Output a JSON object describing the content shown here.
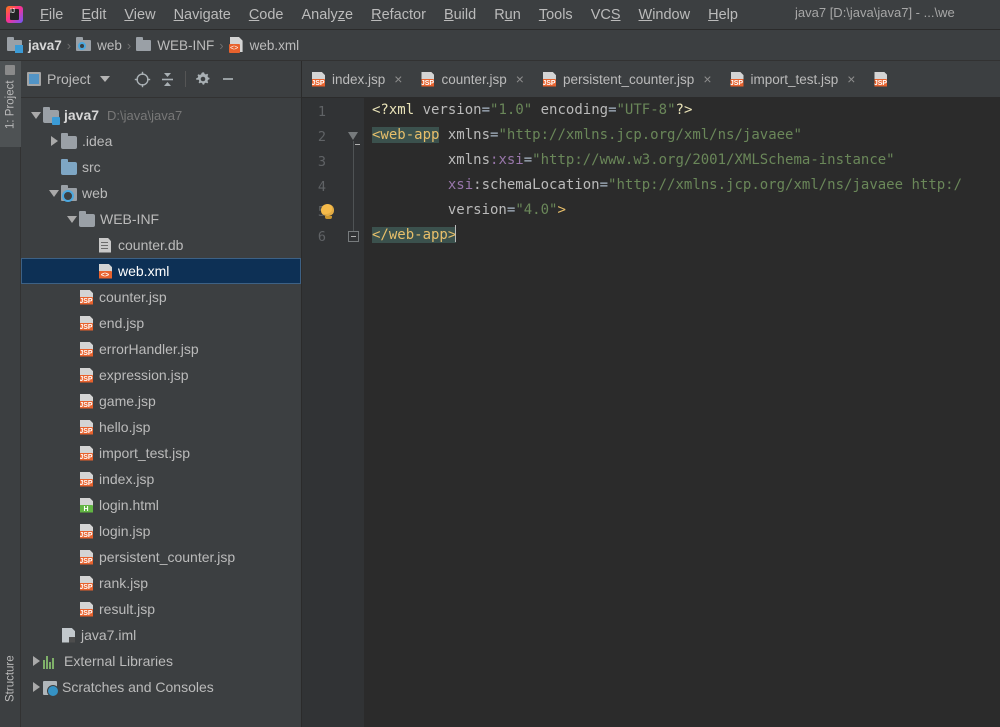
{
  "window": {
    "title": "java7 [D:\\java\\java7] - ...\\we",
    "logo_icon": "intellij-idea-logo"
  },
  "menubar": {
    "items": [
      {
        "label": "File",
        "mnemonic": "F"
      },
      {
        "label": "Edit",
        "mnemonic": "E"
      },
      {
        "label": "View",
        "mnemonic": "V"
      },
      {
        "label": "Navigate",
        "mnemonic": "N"
      },
      {
        "label": "Code",
        "mnemonic": "C"
      },
      {
        "label": "Analyze",
        "mnemonic": "z"
      },
      {
        "label": "Refactor",
        "mnemonic": "R"
      },
      {
        "label": "Build",
        "mnemonic": "B"
      },
      {
        "label": "Run",
        "mnemonic": "u"
      },
      {
        "label": "Tools",
        "mnemonic": "T"
      },
      {
        "label": "VCS",
        "mnemonic": "S"
      },
      {
        "label": "Window",
        "mnemonic": "W"
      },
      {
        "label": "Help",
        "mnemonic": "H"
      }
    ]
  },
  "breadcrumb": {
    "items": [
      {
        "label": "java7",
        "icon": "module-folder-icon"
      },
      {
        "label": "web",
        "icon": "web-folder-icon"
      },
      {
        "label": "WEB-INF",
        "icon": "folder-icon"
      },
      {
        "label": "web.xml",
        "icon": "xml-file-icon"
      }
    ],
    "separator": "›"
  },
  "left_strip": {
    "project_tab": "1: Project",
    "structure_tab": "Structure"
  },
  "project_panel": {
    "title": "Project",
    "title_icon": "project-view-icon",
    "toolbar": [
      {
        "name": "locate-icon",
        "glyph": "⊕"
      },
      {
        "name": "collapse-all-icon",
        "glyph": "≡"
      },
      {
        "name": "settings-gear-icon",
        "glyph": "⚙"
      },
      {
        "name": "hide-panel-icon",
        "glyph": "−"
      }
    ],
    "tree": [
      {
        "label": "java7",
        "path": "D:\\java\\java7",
        "depth": 0,
        "arrow": "open",
        "icon": "module-folder",
        "bold": true,
        "selected": false
      },
      {
        "label": ".idea",
        "path": "",
        "depth": 1,
        "arrow": "closed",
        "icon": "folder",
        "bold": false,
        "selected": false
      },
      {
        "label": "src",
        "path": "",
        "depth": 1,
        "arrow": "none",
        "icon": "source-folder",
        "bold": false,
        "selected": false
      },
      {
        "label": "web",
        "path": "",
        "depth": 1,
        "arrow": "open",
        "icon": "web-folder",
        "bold": false,
        "selected": false
      },
      {
        "label": "WEB-INF",
        "path": "",
        "depth": 2,
        "arrow": "open",
        "icon": "folder",
        "bold": false,
        "selected": false
      },
      {
        "label": "counter.db",
        "path": "",
        "depth": 3,
        "arrow": "none",
        "icon": "db-file",
        "bold": false,
        "selected": false
      },
      {
        "label": "web.xml",
        "path": "",
        "depth": 3,
        "arrow": "none",
        "icon": "xml-file",
        "bold": false,
        "selected": true
      },
      {
        "label": "counter.jsp",
        "path": "",
        "depth": 2,
        "arrow": "none",
        "icon": "jsp-file",
        "bold": false,
        "selected": false
      },
      {
        "label": "end.jsp",
        "path": "",
        "depth": 2,
        "arrow": "none",
        "icon": "jsp-file",
        "bold": false,
        "selected": false
      },
      {
        "label": "errorHandler.jsp",
        "path": "",
        "depth": 2,
        "arrow": "none",
        "icon": "jsp-file",
        "bold": false,
        "selected": false
      },
      {
        "label": "expression.jsp",
        "path": "",
        "depth": 2,
        "arrow": "none",
        "icon": "jsp-file",
        "bold": false,
        "selected": false
      },
      {
        "label": "game.jsp",
        "path": "",
        "depth": 2,
        "arrow": "none",
        "icon": "jsp-file",
        "bold": false,
        "selected": false
      },
      {
        "label": "hello.jsp",
        "path": "",
        "depth": 2,
        "arrow": "none",
        "icon": "jsp-file",
        "bold": false,
        "selected": false
      },
      {
        "label": "import_test.jsp",
        "path": "",
        "depth": 2,
        "arrow": "none",
        "icon": "jsp-file",
        "bold": false,
        "selected": false
      },
      {
        "label": "index.jsp",
        "path": "",
        "depth": 2,
        "arrow": "none",
        "icon": "jsp-file",
        "bold": false,
        "selected": false
      },
      {
        "label": "login.html",
        "path": "",
        "depth": 2,
        "arrow": "none",
        "icon": "html-file",
        "bold": false,
        "selected": false
      },
      {
        "label": "login.jsp",
        "path": "",
        "depth": 2,
        "arrow": "none",
        "icon": "jsp-file",
        "bold": false,
        "selected": false
      },
      {
        "label": "persistent_counter.jsp",
        "path": "",
        "depth": 2,
        "arrow": "none",
        "icon": "jsp-file",
        "bold": false,
        "selected": false
      },
      {
        "label": "rank.jsp",
        "path": "",
        "depth": 2,
        "arrow": "none",
        "icon": "jsp-file",
        "bold": false,
        "selected": false
      },
      {
        "label": "result.jsp",
        "path": "",
        "depth": 2,
        "arrow": "none",
        "icon": "jsp-file",
        "bold": false,
        "selected": false
      },
      {
        "label": "java7.iml",
        "path": "",
        "depth": 1,
        "arrow": "none",
        "icon": "iml-file",
        "bold": false,
        "selected": false
      },
      {
        "label": "External Libraries",
        "path": "",
        "depth": 0,
        "arrow": "closed",
        "icon": "libraries",
        "bold": false,
        "selected": false
      },
      {
        "label": "Scratches and Consoles",
        "path": "",
        "depth": 0,
        "arrow": "closed",
        "icon": "scratches",
        "bold": false,
        "selected": false
      }
    ]
  },
  "editor_tabs": [
    {
      "label": "index.jsp",
      "icon": "jsp-file",
      "active": false,
      "close": "×"
    },
    {
      "label": "counter.jsp",
      "icon": "jsp-file",
      "active": false,
      "close": "×"
    },
    {
      "label": "persistent_counter.jsp",
      "icon": "jsp-file",
      "active": false,
      "close": "×"
    },
    {
      "label": "import_test.jsp",
      "icon": "jsp-file",
      "active": false,
      "close": "×"
    },
    {
      "label": "",
      "icon": "jsp-file",
      "active": false,
      "close": ""
    }
  ],
  "editor": {
    "file": "web.xml",
    "line_numbers": [
      "1",
      "2",
      "3",
      "4",
      "5",
      "6"
    ],
    "lightbulb_line": 5,
    "caret_line": 6,
    "lines": [
      {
        "n": 1,
        "tokens": [
          {
            "t": "<?xml ",
            "c": "tk-proc"
          },
          {
            "t": "version",
            "c": "tk-attr"
          },
          {
            "t": "=",
            "c": "tk-punct"
          },
          {
            "t": "\"1.0\"",
            "c": "tk-val"
          },
          {
            "t": " ",
            "c": "tk-punct"
          },
          {
            "t": "encoding",
            "c": "tk-attr"
          },
          {
            "t": "=",
            "c": "tk-punct"
          },
          {
            "t": "\"UTF-8\"",
            "c": "tk-val"
          },
          {
            "t": "?>",
            "c": "tk-proc"
          }
        ]
      },
      {
        "n": 2,
        "tokens": [
          {
            "t": "<web-app",
            "c": "tk-tag tag-hl"
          },
          {
            "t": " ",
            "c": "tk-punct"
          },
          {
            "t": "xmlns",
            "c": "tk-attr"
          },
          {
            "t": "=",
            "c": "tk-punct"
          },
          {
            "t": "\"http://xmlns.jcp.org/xml/ns/javaee\"",
            "c": "tk-val"
          }
        ]
      },
      {
        "n": 3,
        "tokens": [
          {
            "t": "         ",
            "c": "tk-punct"
          },
          {
            "t": "xmlns",
            "c": "tk-attr"
          },
          {
            "t": ":xsi",
            "c": "tk-ns"
          },
          {
            "t": "=",
            "c": "tk-punct"
          },
          {
            "t": "\"http://www.w3.org/2001/XMLSchema-instance\"",
            "c": "tk-val"
          }
        ]
      },
      {
        "n": 4,
        "tokens": [
          {
            "t": "         ",
            "c": "tk-punct"
          },
          {
            "t": "xsi",
            "c": "tk-ns"
          },
          {
            "t": ":schemaLocation",
            "c": "tk-attr"
          },
          {
            "t": "=",
            "c": "tk-punct"
          },
          {
            "t": "\"http://xmlns.jcp.org/xml/ns/javaee http:/",
            "c": "tk-val"
          }
        ]
      },
      {
        "n": 5,
        "tokens": [
          {
            "t": "         ",
            "c": "tk-punct"
          },
          {
            "t": "version",
            "c": "tk-attr"
          },
          {
            "t": "=",
            "c": "tk-punct"
          },
          {
            "t": "\"4.0\"",
            "c": "tk-val"
          },
          {
            "t": ">",
            "c": "tk-tag"
          }
        ]
      },
      {
        "n": 6,
        "tokens": [
          {
            "t": "</web-app>",
            "c": "tk-tag tag-hl"
          }
        ]
      }
    ]
  },
  "colors": {
    "chrome_bg": "#3c3f41",
    "editor_bg": "#2b2b2b",
    "gutter_bg": "#313335",
    "selection_bg": "#0d3055",
    "selection_border": "#3d6185",
    "tag_color": "#e8bf6a",
    "string_color": "#6a8759",
    "ns_color": "#9876aa",
    "attr_color": "#bababa",
    "matching_tag_bg": "#3b514d",
    "jsp_badge": "#e8622d",
    "html_badge": "#62b543",
    "accent_blue": "#3592c4"
  }
}
